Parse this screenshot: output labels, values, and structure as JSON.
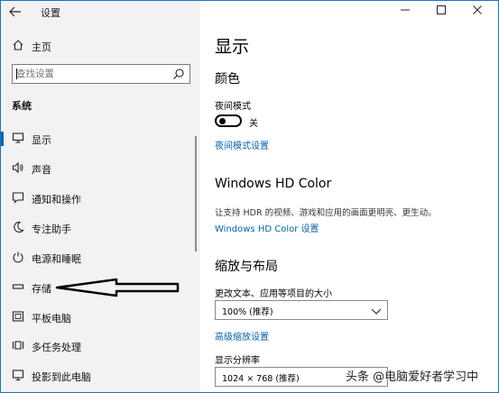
{
  "window": {
    "title": "设置",
    "back_icon": "back-arrow-icon",
    "controls": [
      "minimize-icon",
      "maximize-icon",
      "close-icon"
    ]
  },
  "sidebar": {
    "home_label": "主页",
    "search_placeholder": "查找设置",
    "section_label": "系统",
    "items": [
      {
        "label": "显示",
        "icon": "monitor-icon",
        "active": true
      },
      {
        "label": "声音",
        "icon": "speaker-icon"
      },
      {
        "label": "通知和操作",
        "icon": "notification-icon"
      },
      {
        "label": "专注助手",
        "icon": "moon-icon"
      },
      {
        "label": "电源和睡眠",
        "icon": "power-icon"
      },
      {
        "label": "存储",
        "icon": "storage-icon"
      },
      {
        "label": "平板电脑",
        "icon": "tablet-icon"
      },
      {
        "label": "多任务处理",
        "icon": "multitask-icon"
      },
      {
        "label": "投影到此电脑",
        "icon": "project-icon"
      }
    ]
  },
  "main": {
    "page_title": "显示",
    "color_section": "颜色",
    "night_mode_label": "夜间模式",
    "night_mode_state": "关",
    "night_mode_on": false,
    "night_mode_link": "夜间模式设置",
    "hdr_section": "Windows HD Color",
    "hdr_desc": "让支持 HDR 的视频、游戏和应用的画面更明亮、更生动。",
    "hdr_link": "Windows HD Color 设置",
    "scale_section": "缩放与布局",
    "scale_label": "更改文本、应用等项目的大小",
    "scale_value": "100% (推荐)",
    "advanced_scale_link": "高级缩放设置",
    "resolution_label": "显示分辨率",
    "resolution_value": "1024 × 768 (推荐)"
  },
  "watermark": "头条 @电脑爱好者学习中",
  "colors": {
    "accent": "#0063b1",
    "sidebar_bg": "#f2f2f2",
    "frame_border": "#1a73c9"
  }
}
